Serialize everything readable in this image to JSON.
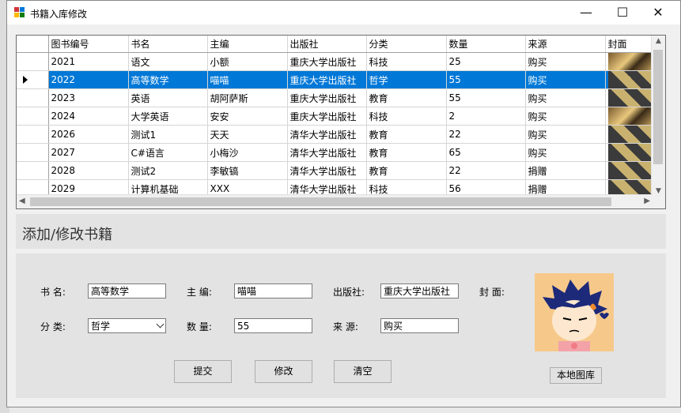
{
  "window": {
    "title": "书籍入库修改",
    "minimize": "—",
    "maximize": "☐",
    "close": "✕"
  },
  "grid": {
    "columns": [
      "图书编号",
      "书名",
      "主编",
      "出版社",
      "分类",
      "数量",
      "来源",
      "封面"
    ],
    "rows": [
      {
        "id": "2021",
        "name": "语文",
        "editor": "小额",
        "publisher": "重庆大学出版社",
        "category": "科技",
        "qty": "25",
        "source": "购买"
      },
      {
        "id": "2022",
        "name": "高等数学",
        "editor": "喵喵",
        "publisher": "重庆大学出版社",
        "category": "哲学",
        "qty": "55",
        "source": "购买"
      },
      {
        "id": "2023",
        "name": "英语",
        "editor": "胡阿萨斯",
        "publisher": "重庆大学出版社",
        "category": "教育",
        "qty": "55",
        "source": "购买"
      },
      {
        "id": "2024",
        "name": "大学英语",
        "editor": "安安",
        "publisher": "重庆大学出版社",
        "category": "科技",
        "qty": "2",
        "source": "购买"
      },
      {
        "id": "2026",
        "name": "测试1",
        "editor": "天天",
        "publisher": "清华大学出版社",
        "category": "教育",
        "qty": "22",
        "source": "购买"
      },
      {
        "id": "2027",
        "name": "C#语言",
        "editor": "小梅沙",
        "publisher": "清华大学出版社",
        "category": "教育",
        "qty": "65",
        "source": "购买"
      },
      {
        "id": "2028",
        "name": "测试2",
        "editor": "李敏镐",
        "publisher": "清华大学出版社",
        "category": "教育",
        "qty": "22",
        "source": "捐赠"
      },
      {
        "id": "2029",
        "name": "计算机基础",
        "editor": "XXX",
        "publisher": "清华大学出版社",
        "category": "科技",
        "qty": "56",
        "source": "捐赠"
      }
    ],
    "selected_index": 1
  },
  "section": {
    "title": "添加/修改书籍"
  },
  "form": {
    "name_label": "书    名:",
    "name_value": "高等数学",
    "editor_label": "主    编:",
    "editor_value": "喵喵",
    "publisher_label": "出版社:",
    "publisher_value": "重庆大学出版社",
    "cover_label": "封    面:",
    "category_label": "分    类:",
    "category_value": "哲学",
    "qty_label": "数    量:",
    "qty_value": "55",
    "source_label": "来    源:",
    "source_value": "购买",
    "submit": "提交",
    "modify": "修改",
    "clear": "清空",
    "local_image": "本地图库"
  },
  "colors": {
    "selection": "#0078d7"
  }
}
